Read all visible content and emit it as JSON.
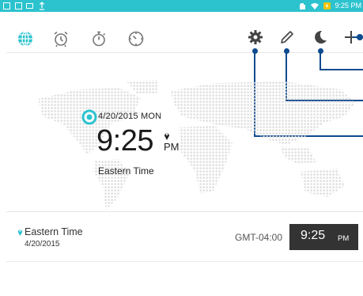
{
  "status_bar": {
    "time": "9:25 PM",
    "background_color": "#2cc3cf",
    "left_icons": [
      "image-icon",
      "calendar-icon",
      "mail-icon",
      "upload-icon"
    ],
    "right_icons": [
      "quiet-hours-icon",
      "wifi-icon",
      "battery-charging-icon"
    ]
  },
  "toolbar": {
    "tabs": [
      {
        "name": "world-clock-tab",
        "icon": "globe-icon",
        "active": true
      },
      {
        "name": "alarm-tab",
        "icon": "alarm-clock-icon",
        "active": false
      },
      {
        "name": "stopwatch-tab",
        "icon": "stopwatch-icon",
        "active": false
      },
      {
        "name": "timer-tab",
        "icon": "timer-icon",
        "active": false
      }
    ],
    "actions": [
      "settings-gear-icon",
      "edit-pencil-icon",
      "night-mode-moon-icon",
      "add-plus-icon"
    ],
    "accent_color": "#2cc3cf"
  },
  "clock": {
    "date": "4/20/2015 MON",
    "time": "9:25",
    "ampm": "PM",
    "zone": "Eastern Time"
  },
  "city_list": [
    {
      "name": "Eastern Time",
      "date": "4/20/2015",
      "gmt": "GMT-04:00",
      "time": "9:25",
      "ampm": "PM"
    }
  ],
  "callout_color": "#0d4a8e"
}
